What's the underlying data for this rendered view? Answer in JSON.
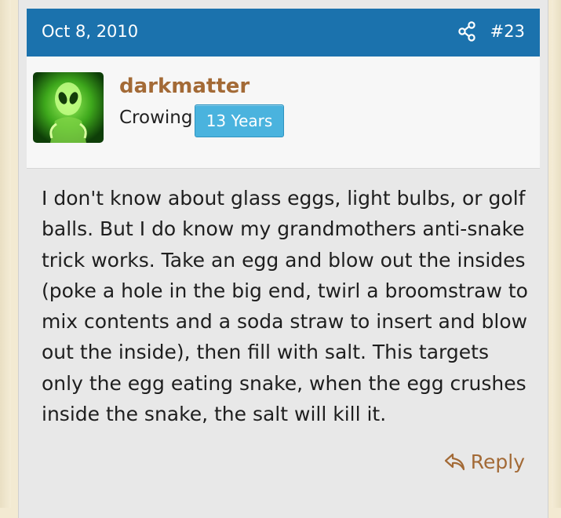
{
  "post": {
    "date": "Oct 8, 2010",
    "number": "#23",
    "share_icon": "share-icon",
    "author": {
      "username": "darkmatter",
      "title": "Crowing",
      "badge": "13 Years",
      "avatar": "green-alien-avatar"
    },
    "body": "I don't know about glass eggs, light bulbs, or golf balls. But I do know my grandmothers anti-snake trick works. Take an egg and blow out the insides (poke a hole in the big end, twirl a broomstraw to mix contents and a soda straw to insert and blow out the inside), then fill with salt. This targets only the egg eating snake, when the egg crushes inside the snake, the salt will kill it.",
    "reply_label": "Reply",
    "reply_icon": "reply-arrow-icon"
  },
  "colors": {
    "header_bg": "#1b72ad",
    "username": "#a36a36",
    "badge_bg": "#4ab3de",
    "page_bg": "#f3ead2",
    "card_bg": "#e8e8e8"
  }
}
